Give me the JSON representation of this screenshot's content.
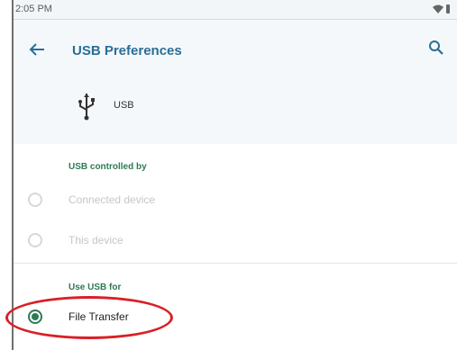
{
  "status_bar": {
    "time": "2:05 PM",
    "icons": [
      "wifi-icon",
      "battery-icon"
    ]
  },
  "app_bar": {
    "title": "USB Preferences",
    "back_icon": "back-arrow-icon",
    "search_icon": "search-icon"
  },
  "device": {
    "icon": "usb-icon",
    "label": "USB"
  },
  "controlled_by": {
    "header": "USB controlled by",
    "options": [
      {
        "label": "Connected device",
        "selected": false
      },
      {
        "label": "This device",
        "selected": false
      }
    ]
  },
  "use_usb_for": {
    "header": "Use USB for",
    "options": [
      {
        "label": "File Transfer",
        "selected": true
      }
    ]
  },
  "colors": {
    "accent_green": "#2e7a54",
    "title_blue": "#2a6d96",
    "annotation_red": "#d82027"
  }
}
